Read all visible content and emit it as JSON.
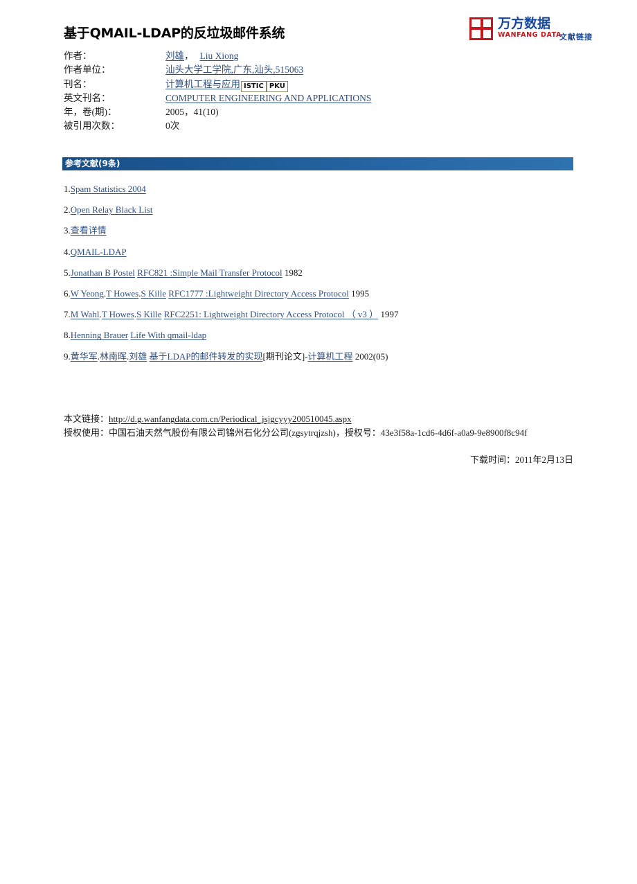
{
  "logo": {
    "mark_name": "wanfang-logo-mark",
    "cn": "万方数据",
    "en": "WANFANG DATA",
    "sub": "文献链接",
    "colors": {
      "red": "#c8161d",
      "blue": "#17489e"
    }
  },
  "title": "基于QMAIL-LDAP的反垃圾邮件系统",
  "meta": {
    "rows": [
      {
        "label": "作者：",
        "authors": [
          "刘雄",
          "Liu Xiong"
        ],
        "separator": "，"
      },
      {
        "label": "作者单位：",
        "value": "汕头大学工学院,广东,汕头,515063"
      },
      {
        "label": "刊名：",
        "value": "计算机工程与应用",
        "badges": [
          "ISTIC",
          "PKU"
        ]
      },
      {
        "label": "英文刊名：",
        "value": "COMPUTER ENGINEERING AND APPLICATIONS"
      },
      {
        "label": "年，卷(期)：",
        "value": "2005，41(10)"
      },
      {
        "label": "被引用次数：",
        "value": "0次"
      }
    ]
  },
  "section": {
    "title": "参考文献(9条)",
    "bar_color_start": "#194f87",
    "bar_color_end": "#2f72b0"
  },
  "references": [
    {
      "num": "1.",
      "parts": [
        {
          "text": "Spam Statistics 2004",
          "link": true
        }
      ]
    },
    {
      "num": "2.",
      "parts": [
        {
          "text": "Open Relay Black List",
          "link": true
        }
      ]
    },
    {
      "num": "3.",
      "parts": [
        {
          "text": "查看详情",
          "link": true
        }
      ]
    },
    {
      "num": "4.",
      "parts": [
        {
          "text": "QMAIL-LDAP",
          "link": true
        }
      ]
    },
    {
      "num": "5.",
      "parts": [
        {
          "text": "Jonathan B Postel",
          "link": true
        },
        {
          "text": " ",
          "link": false
        },
        {
          "text": "RFC821 :Simple Mail Transfer Protocol",
          "link": true
        },
        {
          "text": " 1982",
          "link": false
        }
      ]
    },
    {
      "num": "6.",
      "parts": [
        {
          "text": "W Yeong",
          "link": true
        },
        {
          "text": ".",
          "link": false
        },
        {
          "text": "T Howes",
          "link": true
        },
        {
          "text": ".",
          "link": false
        },
        {
          "text": "S Kille",
          "link": true
        },
        {
          "text": " ",
          "link": false
        },
        {
          "text": "RFC1777 :Lightweight Directory Access Protocol",
          "link": true
        },
        {
          "text": " 1995",
          "link": false
        }
      ]
    },
    {
      "num": "7.",
      "parts": [
        {
          "text": "M Wahl",
          "link": true
        },
        {
          "text": ".",
          "link": false
        },
        {
          "text": "T Howes",
          "link": true
        },
        {
          "text": ".",
          "link": false
        },
        {
          "text": "S Kille",
          "link": true
        },
        {
          "text": " ",
          "link": false
        },
        {
          "text": "RFC2251: Lightweight Directory Access Protocol （ v3 ）",
          "link": true
        },
        {
          "text": " 1997",
          "link": false
        }
      ]
    },
    {
      "num": "8.",
      "parts": [
        {
          "text": "Henning Brauer",
          "link": true
        },
        {
          "text": " ",
          "link": false
        },
        {
          "text": "Life With qmail-ldap",
          "link": true
        }
      ]
    },
    {
      "num": "9.",
      "parts": [
        {
          "text": "黄华军",
          "link": true
        },
        {
          "text": ".",
          "link": false
        },
        {
          "text": "林南晖",
          "link": true
        },
        {
          "text": ".",
          "link": false
        },
        {
          "text": "刘雄",
          "link": true
        },
        {
          "text": " ",
          "link": false
        },
        {
          "text": "基于LDAP的邮件转发的实现",
          "link": true
        },
        {
          "text": "[期刊论文]-",
          "link": false
        },
        {
          "text": "计算机工程",
          "link": true
        },
        {
          "text": " 2002(05)",
          "link": false
        }
      ]
    }
  ],
  "footer": {
    "link_label": "本文链接：",
    "link_url": "http://d.g.wanfangdata.com.cn/Periodical_jsjgcyyy200510045.aspx",
    "auth_label": "授权使用：",
    "auth_value": "中国石油天然气股份有限公司锦州石化分公司(zgsytrqjzsh)，授权号：43e3f58a-1cd6-4d6f-a0a9-9e8900f8c94f",
    "download_label": "下载时间：",
    "download_value": "2011年2月13日"
  }
}
